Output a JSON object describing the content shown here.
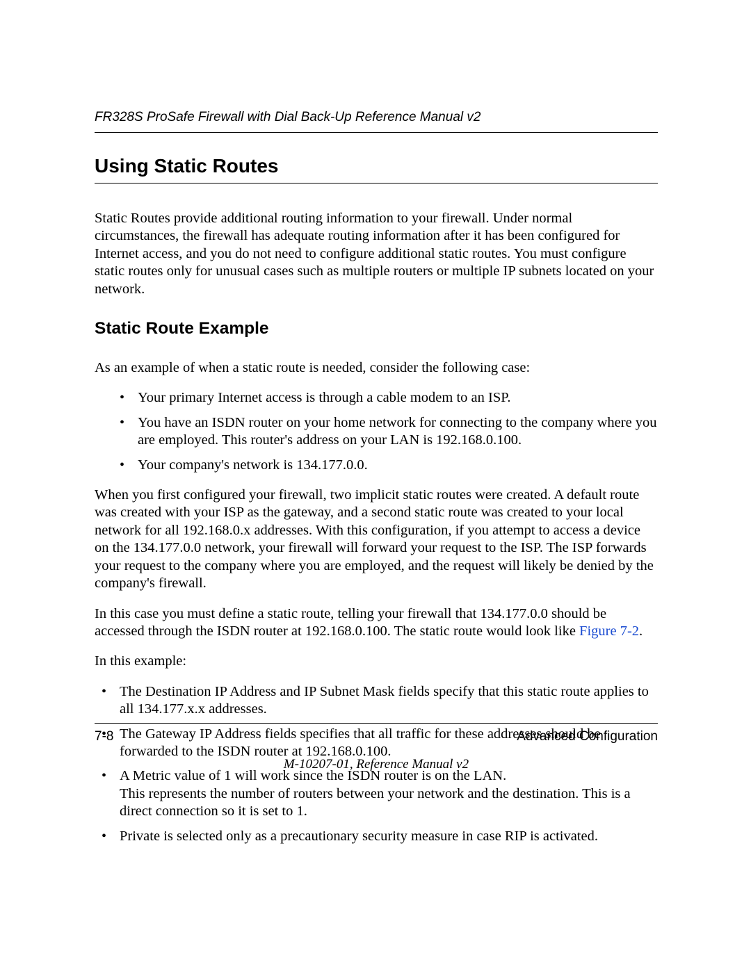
{
  "header": {
    "title": "FR328S ProSafe Firewall with Dial Back-Up Reference Manual v2"
  },
  "section": {
    "h1": "Using Static Routes",
    "intro": "Static Routes provide additional routing information to your firewall. Under normal circumstances, the firewall has adequate routing information after it has been configured for Internet access, and you do not need to configure additional static routes. You must configure static routes only for unusual cases such as multiple routers or multiple IP subnets located on your network."
  },
  "subsection": {
    "h2": "Static Route Example",
    "lead": "As an example of when a static route is needed, consider the following case:",
    "bullets1": [
      "Your primary Internet access is through a cable modem to an ISP.",
      "You have an ISDN router on your home network for connecting to the company where you are employed. This router's address on your LAN is 192.168.0.100.",
      "Your company's network is 134.177.0.0."
    ],
    "para2": "When you first configured your firewall, two implicit static routes were created. A default route was created with your ISP as the gateway, and a second static route was created to your local network for all 192.168.0.x addresses. With this configuration, if you attempt to access a device on the 134.177.0.0 network, your firewall will forward your request to the ISP. The ISP forwards your request to the company where you are employed, and the request will likely be denied by the company's firewall.",
    "para3_pre": "In this case you must define a static route, telling your firewall that 134.177.0.0 should be accessed through the ISDN router at 192.168.0.100. The static route would look like ",
    "figref": "Figure 7-2",
    "para3_post": ".",
    "para4": "In this example:",
    "bullets2": [
      "The Destination IP Address and IP Subnet Mask fields specify that this static route applies to all 134.177.x.x addresses.",
      "The Gateway IP Address fields specifies that all traffic for these addresses should be forwarded to the ISDN router at 192.168.0.100.",
      "A Metric value of 1 will work since the ISDN router is on the LAN.\nThis represents the number of routers between your network and the destination. This is a direct connection so it is set to 1.",
      "Private is selected only as a precautionary security measure in case RIP is activated."
    ]
  },
  "footer": {
    "page": "7-8",
    "chapter": "Advanced Configuration",
    "docid": "M-10207-01, Reference Manual v2"
  }
}
